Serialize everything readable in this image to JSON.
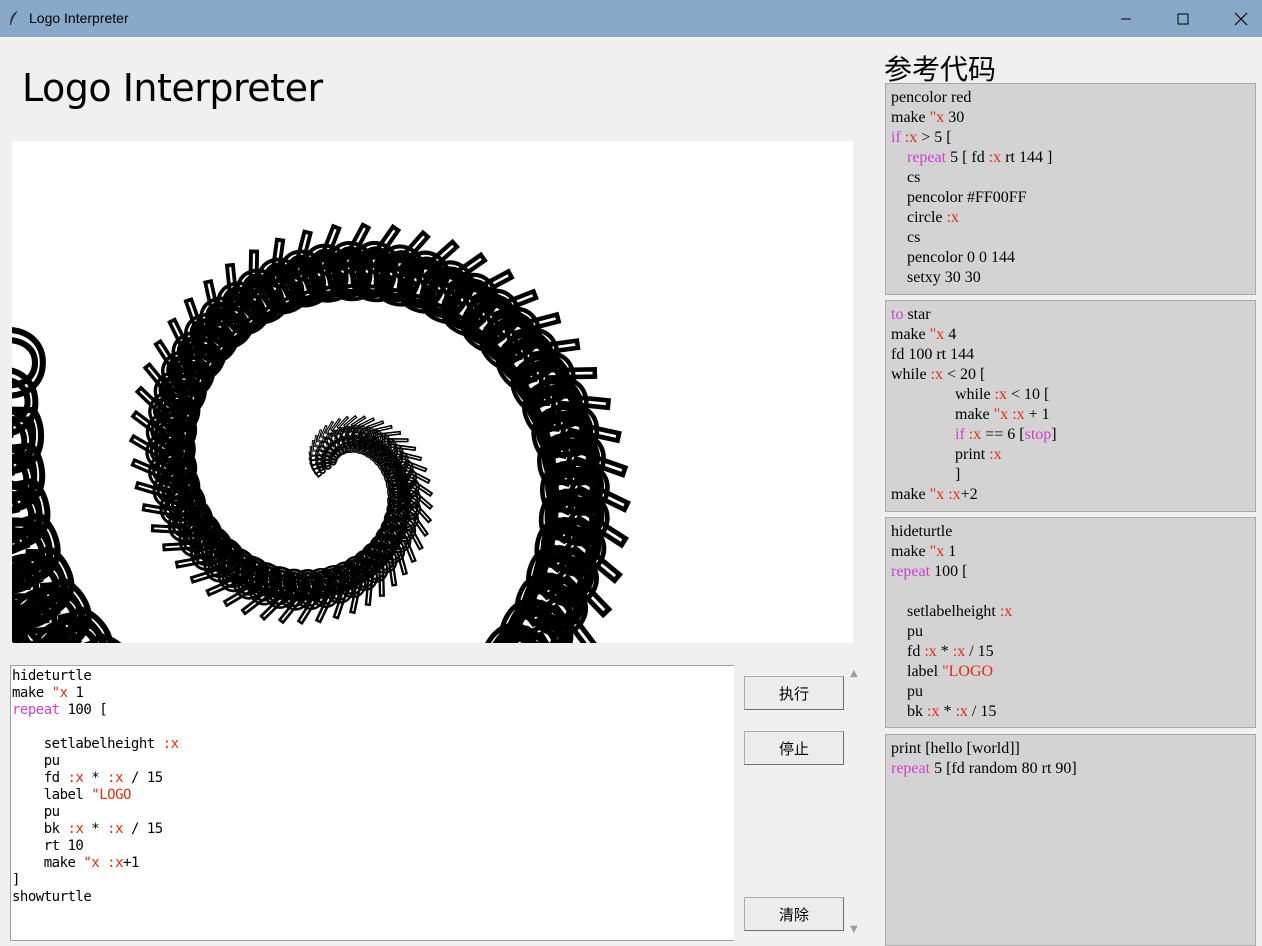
{
  "window": {
    "title": "Logo Interpreter"
  },
  "app": {
    "heading": "Logo Interpreter"
  },
  "canvas": {
    "label_text": "LOGO",
    "fill": "#ffffff",
    "ink": "#000000"
  },
  "editor": {
    "lines": [
      [
        {
          "t": "hideturtle"
        }
      ],
      [
        {
          "t": "make "
        },
        {
          "t": "\"x",
          "c": "var"
        },
        {
          "t": " 1"
        }
      ],
      [
        {
          "t": "repeat",
          "c": "kw"
        },
        {
          "t": " 100 ["
        }
      ],
      [
        {
          "t": ""
        }
      ],
      [
        {
          "t": "    setlabelheight "
        },
        {
          "t": ":x",
          "c": "var"
        }
      ],
      [
        {
          "t": "    pu"
        }
      ],
      [
        {
          "t": "    fd "
        },
        {
          "t": ":x",
          "c": "var"
        },
        {
          "t": " * "
        },
        {
          "t": ":x",
          "c": "var"
        },
        {
          "t": " / 15"
        }
      ],
      [
        {
          "t": "    label "
        },
        {
          "t": "\"LOGO",
          "c": "str"
        }
      ],
      [
        {
          "t": "    pu"
        }
      ],
      [
        {
          "t": "    bk "
        },
        {
          "t": ":x",
          "c": "var"
        },
        {
          "t": " * "
        },
        {
          "t": ":x",
          "c": "var"
        },
        {
          "t": " / 15"
        }
      ],
      [
        {
          "t": "    rt 10"
        }
      ],
      [
        {
          "t": "    make "
        },
        {
          "t": "\"x",
          "c": "var"
        },
        {
          "t": " "
        },
        {
          "t": ":x",
          "c": "var"
        },
        {
          "t": "+1"
        }
      ],
      [
        {
          "t": "]"
        }
      ],
      [
        {
          "t": "showturtle"
        }
      ]
    ]
  },
  "buttons": {
    "run": "执行",
    "stop": "停止",
    "clear": "清除"
  },
  "reference": {
    "heading": "参考代码",
    "samples": [
      [
        [
          {
            "t": "pencolor red"
          }
        ],
        [
          {
            "t": "make "
          },
          {
            "t": "\"x",
            "c": "var"
          },
          {
            "t": " 30"
          }
        ],
        [
          {
            "t": "if",
            "c": "kw"
          },
          {
            "t": " "
          },
          {
            "t": ":x",
            "c": "var"
          },
          {
            "t": " > 5 ["
          }
        ],
        [
          {
            "t": "    "
          },
          {
            "t": "repeat",
            "c": "kw"
          },
          {
            "t": " 5 [ fd "
          },
          {
            "t": ":x",
            "c": "var"
          },
          {
            "t": " rt 144 ]"
          }
        ],
        [
          {
            "t": "    cs"
          }
        ],
        [
          {
            "t": "    pencolor #FF00FF"
          }
        ],
        [
          {
            "t": "    circle "
          },
          {
            "t": ":x",
            "c": "var"
          }
        ],
        [
          {
            "t": "    cs"
          }
        ],
        [
          {
            "t": "    pencolor 0 0 144"
          }
        ],
        [
          {
            "t": "    setxy 30 30"
          }
        ]
      ],
      [
        [
          {
            "t": "to",
            "c": "kw"
          },
          {
            "t": " star"
          }
        ],
        [
          {
            "t": "make "
          },
          {
            "t": "\"x",
            "c": "var"
          },
          {
            "t": " 4"
          }
        ],
        [
          {
            "t": "fd 100 rt 144"
          }
        ],
        [
          {
            "t": "while "
          },
          {
            "t": ":x",
            "c": "var"
          },
          {
            "t": " < 20 ["
          }
        ],
        [
          {
            "t": "                while "
          },
          {
            "t": ":x",
            "c": "var"
          },
          {
            "t": " < 10 ["
          }
        ],
        [
          {
            "t": "                make "
          },
          {
            "t": "\"x",
            "c": "var"
          },
          {
            "t": " "
          },
          {
            "t": ":x",
            "c": "var"
          },
          {
            "t": " + 1"
          }
        ],
        [
          {
            "t": "                "
          },
          {
            "t": "if",
            "c": "kw"
          },
          {
            "t": " "
          },
          {
            "t": ":x",
            "c": "var"
          },
          {
            "t": " == 6 ["
          },
          {
            "t": "stop",
            "c": "kw"
          },
          {
            "t": "]"
          }
        ],
        [
          {
            "t": "                print "
          },
          {
            "t": ":x",
            "c": "var"
          }
        ],
        [
          {
            "t": "                ]"
          }
        ],
        [
          {
            "t": "make "
          },
          {
            "t": "\"x",
            "c": "var"
          },
          {
            "t": " "
          },
          {
            "t": ":x",
            "c": "var"
          },
          {
            "t": "+2"
          }
        ]
      ],
      [
        [
          {
            "t": "hideturtle"
          }
        ],
        [
          {
            "t": "make "
          },
          {
            "t": "\"x",
            "c": "var"
          },
          {
            "t": " 1"
          }
        ],
        [
          {
            "t": "repeat",
            "c": "kw"
          },
          {
            "t": " 100 ["
          }
        ],
        [
          {
            "t": ""
          }
        ],
        [
          {
            "t": "    setlabelheight "
          },
          {
            "t": ":x",
            "c": "var"
          }
        ],
        [
          {
            "t": "    pu"
          }
        ],
        [
          {
            "t": "    fd "
          },
          {
            "t": ":x",
            "c": "var"
          },
          {
            "t": " * "
          },
          {
            "t": ":x",
            "c": "var"
          },
          {
            "t": " / 15"
          }
        ],
        [
          {
            "t": "    label "
          },
          {
            "t": "\"LOGO",
            "c": "str"
          }
        ],
        [
          {
            "t": "    pu"
          }
        ],
        [
          {
            "t": "    bk "
          },
          {
            "t": ":x",
            "c": "var"
          },
          {
            "t": " * "
          },
          {
            "t": ":x",
            "c": "var"
          },
          {
            "t": " / 15"
          }
        ]
      ],
      [
        [
          {
            "t": "print [hello [world]]"
          }
        ],
        [
          {
            "t": "repeat",
            "c": "kw"
          },
          {
            "t": " 5 [fd random 80 rt 90]"
          }
        ]
      ]
    ]
  },
  "colors": {
    "titlebar": "#89a9c8",
    "keyword": "#d03fd0",
    "variable": "#e02d10",
    "card": "#d3d3d3"
  }
}
